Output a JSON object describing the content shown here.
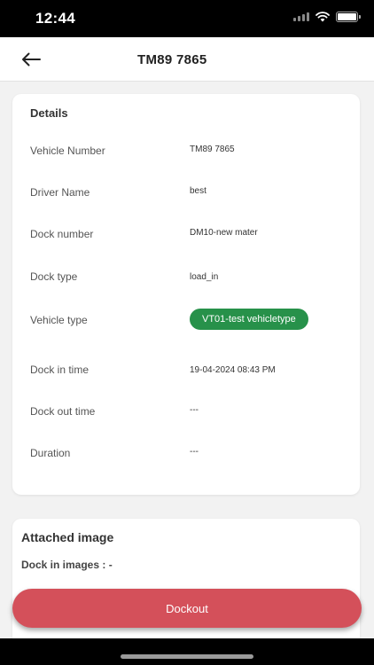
{
  "status_bar": {
    "time": "12:44"
  },
  "header": {
    "title": "TM89 7865"
  },
  "details": {
    "title": "Details",
    "rows": [
      {
        "label": "Vehicle Number",
        "value": "TM89 7865"
      },
      {
        "label": "Driver Name",
        "value": "best"
      },
      {
        "label": "Dock number",
        "value": "DM10-new mater"
      },
      {
        "label": "Dock type",
        "value": "load_in"
      },
      {
        "label": "Vehicle type",
        "value": "VT01-test vehicletype"
      },
      {
        "label": "Dock in time",
        "value": "19-04-2024 08:43 PM"
      },
      {
        "label": "Dock out time",
        "value": "---"
      },
      {
        "label": "Duration",
        "value": "---"
      }
    ]
  },
  "attached": {
    "title": "Attached image",
    "dock_in_label": "Dock in images : -"
  },
  "actions": {
    "dockout_label": "Dockout"
  },
  "colors": {
    "badge": "#27914a",
    "dockout": "#d4505a"
  },
  "icons": {
    "back": "arrow-left-icon",
    "signal": "cellular-signal-icon",
    "wifi": "wifi-icon",
    "battery": "battery-icon"
  }
}
